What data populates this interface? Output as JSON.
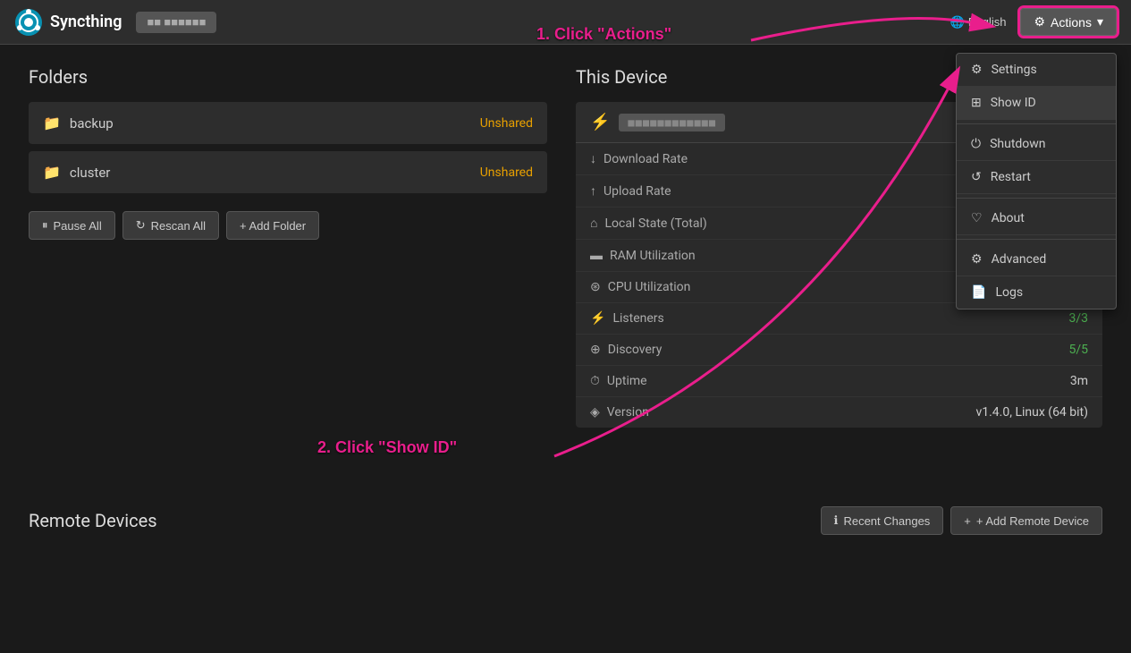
{
  "navbar": {
    "brand": "Syncthing",
    "status_placeholder": "■■ ■■■■■■",
    "lang_label": "English",
    "actions_label": "Actions"
  },
  "dropdown": {
    "items": [
      {
        "id": "settings",
        "icon": "⚙",
        "label": "Settings"
      },
      {
        "id": "show-id",
        "icon": "⊞",
        "label": "Show ID"
      },
      {
        "id": "shutdown",
        "icon": "⏻",
        "label": "Shutdown"
      },
      {
        "id": "restart",
        "icon": "↺",
        "label": "Restart"
      },
      {
        "id": "about",
        "icon": "♡",
        "label": "About"
      },
      {
        "id": "advanced",
        "icon": "⚙",
        "label": "Advanced"
      },
      {
        "id": "logs",
        "icon": "📄",
        "label": "Logs"
      }
    ]
  },
  "folders": {
    "title": "Folders",
    "items": [
      {
        "name": "backup",
        "status": "Unshared"
      },
      {
        "name": "cluster",
        "status": "Unshared"
      }
    ],
    "buttons": {
      "pause_all": "Pause All",
      "rescan_all": "Rescan All",
      "add_folder": "+ Add Folder"
    }
  },
  "this_device": {
    "title": "This Device",
    "device_id": "■■■■■■■■■■■■",
    "stats": [
      {
        "label": "Download Rate",
        "icon": "↓",
        "value": ""
      },
      {
        "label": "Upload Rate",
        "icon": "↑",
        "value": ""
      },
      {
        "label": "Local State (Total)",
        "icon": "⌂",
        "value": ""
      },
      {
        "label": "RAM Utilization",
        "icon": "▬",
        "value": ""
      },
      {
        "label": "CPU Utilization",
        "icon": "⊛",
        "value": ""
      },
      {
        "label": "Listeners",
        "icon": "⚡",
        "value": "3/3",
        "color": "green"
      },
      {
        "label": "Discovery",
        "icon": "⊕",
        "value": "5/5",
        "color": "green"
      },
      {
        "label": "Uptime",
        "icon": "⏱",
        "value": "3m"
      },
      {
        "label": "Version",
        "icon": "◈",
        "value": "v1.4.0, Linux (64 bit)"
      }
    ]
  },
  "remote_devices": {
    "title": "Remote Devices",
    "buttons": {
      "recent_changes": "Recent Changes",
      "add_remote": "+ Add Remote Device"
    }
  },
  "annotations": {
    "step1": "1. Click \"Actions\"",
    "step2": "2. Click \"Show ID\""
  }
}
